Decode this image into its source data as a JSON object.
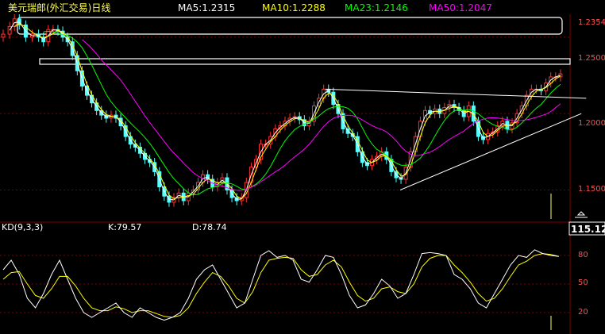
{
  "header": {
    "title": "美元瑞郎(外汇交易)日线",
    "ma5": "MA5:1.2315",
    "ma10": "MA10:1.2288",
    "ma23": "MA23:1.2146",
    "ma50": "MA50:1.2047"
  },
  "kd_header": {
    "name": "KD(9,3,3)",
    "k": "K:79.57",
    "d": "D:78.74"
  },
  "price_axis_labels": [
    "1.2354",
    "1.2500",
    "1.2000",
    "1.1500"
  ],
  "cursor_value": "115.12",
  "kd_axis_labels": [
    "80",
    "50",
    "20"
  ],
  "colors": {
    "ma5": "#ffffff",
    "ma10": "#ffff00",
    "ma23": "#00ff00",
    "ma50": "#ff00ff",
    "up_candle": "#ff3232",
    "down_candle": "#54ffff",
    "grid": "#800000",
    "k_line": "#ffffff",
    "d_line": "#ffff00"
  },
  "chart_data": {
    "type": "candlestick",
    "price_range": [
      1.13,
      1.265
    ],
    "price_ticks": [
      1.15,
      1.2,
      1.25
    ],
    "close_series": [
      [
        0,
        1.252
      ],
      [
        8,
        1.257
      ],
      [
        14,
        1.262
      ],
      [
        20,
        1.258
      ],
      [
        28,
        1.25
      ],
      [
        36,
        1.252
      ],
      [
        44,
        1.25
      ],
      [
        50,
        1.247
      ],
      [
        56,
        1.255
      ],
      [
        62,
        1.255
      ],
      [
        68,
        1.254
      ],
      [
        74,
        1.25
      ],
      [
        80,
        1.247
      ],
      [
        86,
        1.238
      ],
      [
        92,
        1.228
      ],
      [
        98,
        1.218
      ],
      [
        104,
        1.212
      ],
      [
        110,
        1.207
      ],
      [
        116,
        1.202
      ],
      [
        122,
        1.199
      ],
      [
        128,
        1.197
      ],
      [
        134,
        1.199
      ],
      [
        140,
        1.197
      ],
      [
        146,
        1.192
      ],
      [
        152,
        1.185
      ],
      [
        158,
        1.18
      ],
      [
        164,
        1.178
      ],
      [
        170,
        1.174
      ],
      [
        176,
        1.17
      ],
      [
        182,
        1.168
      ],
      [
        188,
        1.162
      ],
      [
        194,
        1.152
      ],
      [
        200,
        1.146
      ],
      [
        206,
        1.142
      ],
      [
        212,
        1.145
      ],
      [
        218,
        1.148
      ],
      [
        224,
        1.143
      ],
      [
        230,
        1.148
      ],
      [
        236,
        1.15
      ],
      [
        242,
        1.155
      ],
      [
        248,
        1.16
      ],
      [
        254,
        1.157
      ],
      [
        260,
        1.152
      ],
      [
        266,
        1.155
      ],
      [
        272,
        1.158
      ],
      [
        278,
        1.15
      ],
      [
        284,
        1.145
      ],
      [
        290,
        1.143
      ],
      [
        296,
        1.145
      ],
      [
        302,
        1.155
      ],
      [
        308,
        1.165
      ],
      [
        314,
        1.17
      ],
      [
        320,
        1.18
      ],
      [
        326,
        1.18
      ],
      [
        332,
        1.185
      ],
      [
        338,
        1.19
      ],
      [
        344,
        1.192
      ],
      [
        350,
        1.195
      ],
      [
        356,
        1.197
      ],
      [
        362,
        1.198
      ],
      [
        368,
        1.196
      ],
      [
        374,
        1.192
      ],
      [
        380,
        1.195
      ],
      [
        386,
        1.205
      ],
      [
        392,
        1.21
      ],
      [
        398,
        1.216
      ],
      [
        404,
        1.214
      ],
      [
        410,
        1.206
      ],
      [
        416,
        1.2
      ],
      [
        422,
        1.19
      ],
      [
        428,
        1.187
      ],
      [
        434,
        1.185
      ],
      [
        440,
        1.175
      ],
      [
        446,
        1.168
      ],
      [
        452,
        1.166
      ],
      [
        458,
        1.17
      ],
      [
        464,
        1.172
      ],
      [
        470,
        1.175
      ],
      [
        476,
        1.17
      ],
      [
        482,
        1.162
      ],
      [
        488,
        1.158
      ],
      [
        494,
        1.157
      ],
      [
        500,
        1.165
      ],
      [
        506,
        1.175
      ],
      [
        512,
        1.185
      ],
      [
        518,
        1.195
      ],
      [
        524,
        1.202
      ],
      [
        530,
        1.2
      ],
      [
        536,
        1.203
      ],
      [
        542,
        1.2
      ],
      [
        548,
        1.204
      ],
      [
        554,
        1.206
      ],
      [
        560,
        1.204
      ],
      [
        566,
        1.202
      ],
      [
        572,
        1.198
      ],
      [
        578,
        1.205
      ],
      [
        584,
        1.195
      ],
      [
        590,
        1.185
      ],
      [
        596,
        1.183
      ],
      [
        602,
        1.187
      ],
      [
        608,
        1.188
      ],
      [
        614,
        1.192
      ],
      [
        620,
        1.195
      ],
      [
        626,
        1.19
      ],
      [
        632,
        1.194
      ],
      [
        638,
        1.2
      ],
      [
        644,
        1.205
      ],
      [
        650,
        1.212
      ],
      [
        656,
        1.216
      ],
      [
        662,
        1.216
      ],
      [
        668,
        1.215
      ],
      [
        674,
        1.22
      ],
      [
        680,
        1.224
      ],
      [
        686,
        1.224
      ],
      [
        692,
        1.226
      ]
    ],
    "trend_lines": [
      {
        "from": [
          400,
          1.216
        ],
        "to": [
          724,
          1.21
        ]
      },
      {
        "from": [
          493,
          1.15
        ],
        "to": [
          718,
          1.2
        ]
      }
    ],
    "kd_range": [
      0,
      100
    ],
    "kd_ticks": [
      80,
      50,
      20
    ],
    "k_series": [
      [
        0,
        65
      ],
      [
        10,
        75
      ],
      [
        20,
        60
      ],
      [
        30,
        35
      ],
      [
        40,
        25
      ],
      [
        50,
        40
      ],
      [
        60,
        60
      ],
      [
        70,
        75
      ],
      [
        80,
        55
      ],
      [
        90,
        35
      ],
      [
        100,
        20
      ],
      [
        110,
        15
      ],
      [
        120,
        20
      ],
      [
        130,
        25
      ],
      [
        140,
        30
      ],
      [
        150,
        20
      ],
      [
        160,
        15
      ],
      [
        170,
        25
      ],
      [
        180,
        20
      ],
      [
        190,
        15
      ],
      [
        200,
        12
      ],
      [
        210,
        15
      ],
      [
        220,
        20
      ],
      [
        230,
        35
      ],
      [
        240,
        55
      ],
      [
        250,
        65
      ],
      [
        260,
        70
      ],
      [
        270,
        55
      ],
      [
        280,
        40
      ],
      [
        290,
        25
      ],
      [
        300,
        30
      ],
      [
        310,
        55
      ],
      [
        320,
        80
      ],
      [
        330,
        85
      ],
      [
        340,
        78
      ],
      [
        350,
        80
      ],
      [
        360,
        75
      ],
      [
        370,
        55
      ],
      [
        380,
        52
      ],
      [
        390,
        65
      ],
      [
        400,
        80
      ],
      [
        410,
        78
      ],
      [
        420,
        60
      ],
      [
        430,
        38
      ],
      [
        440,
        25
      ],
      [
        450,
        28
      ],
      [
        460,
        40
      ],
      [
        470,
        55
      ],
      [
        480,
        48
      ],
      [
        490,
        35
      ],
      [
        500,
        40
      ],
      [
        510,
        60
      ],
      [
        520,
        82
      ],
      [
        530,
        83
      ],
      [
        540,
        82
      ],
      [
        550,
        80
      ],
      [
        560,
        60
      ],
      [
        570,
        55
      ],
      [
        580,
        45
      ],
      [
        590,
        30
      ],
      [
        600,
        25
      ],
      [
        610,
        40
      ],
      [
        620,
        55
      ],
      [
        630,
        70
      ],
      [
        640,
        80
      ],
      [
        650,
        78
      ],
      [
        660,
        86
      ],
      [
        670,
        82
      ],
      [
        680,
        80
      ],
      [
        690,
        79
      ]
    ],
    "d_series": [
      [
        0,
        55
      ],
      [
        10,
        62
      ],
      [
        20,
        63
      ],
      [
        30,
        50
      ],
      [
        40,
        38
      ],
      [
        50,
        35
      ],
      [
        60,
        45
      ],
      [
        70,
        58
      ],
      [
        80,
        58
      ],
      [
        90,
        48
      ],
      [
        100,
        35
      ],
      [
        110,
        25
      ],
      [
        120,
        22
      ],
      [
        130,
        22
      ],
      [
        140,
        26
      ],
      [
        150,
        24
      ],
      [
        160,
        20
      ],
      [
        170,
        22
      ],
      [
        180,
        22
      ],
      [
        190,
        19
      ],
      [
        200,
        16
      ],
      [
        210,
        15
      ],
      [
        220,
        17
      ],
      [
        230,
        25
      ],
      [
        240,
        40
      ],
      [
        250,
        52
      ],
      [
        260,
        62
      ],
      [
        270,
        58
      ],
      [
        280,
        48
      ],
      [
        290,
        35
      ],
      [
        300,
        30
      ],
      [
        310,
        42
      ],
      [
        320,
        62
      ],
      [
        330,
        75
      ],
      [
        340,
        77
      ],
      [
        350,
        78
      ],
      [
        360,
        77
      ],
      [
        370,
        65
      ],
      [
        380,
        58
      ],
      [
        390,
        60
      ],
      [
        400,
        70
      ],
      [
        410,
        75
      ],
      [
        420,
        68
      ],
      [
        430,
        52
      ],
      [
        440,
        38
      ],
      [
        450,
        32
      ],
      [
        460,
        35
      ],
      [
        470,
        45
      ],
      [
        480,
        47
      ],
      [
        490,
        42
      ],
      [
        500,
        40
      ],
      [
        510,
        50
      ],
      [
        520,
        68
      ],
      [
        530,
        77
      ],
      [
        540,
        80
      ],
      [
        550,
        80
      ],
      [
        560,
        70
      ],
      [
        570,
        62
      ],
      [
        580,
        52
      ],
      [
        590,
        40
      ],
      [
        600,
        32
      ],
      [
        610,
        35
      ],
      [
        620,
        45
      ],
      [
        630,
        58
      ],
      [
        640,
        70
      ],
      [
        650,
        74
      ],
      [
        660,
        80
      ],
      [
        670,
        82
      ],
      [
        680,
        81
      ],
      [
        690,
        79
      ]
    ]
  }
}
